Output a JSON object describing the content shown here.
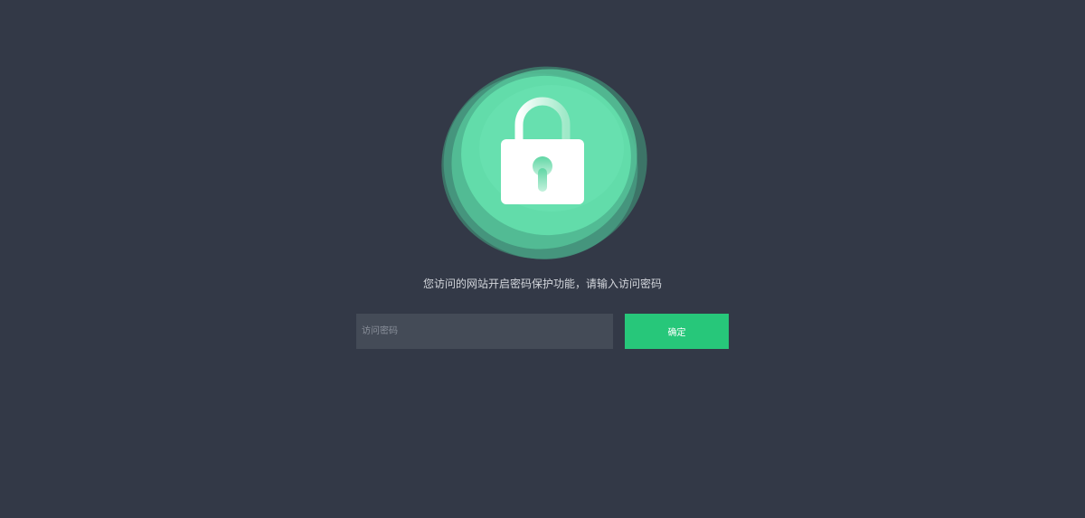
{
  "lock": {
    "icon": "padlock-icon",
    "colors": {
      "blob_dark": "#3f8a75",
      "blob_mid": "#4fb893",
      "blob_light": "#64e0ae",
      "lock_body": "#ffffff",
      "keyhole": "#6cdcad"
    }
  },
  "message": "您访问的网站开启密码保护功能，请输入访问密码",
  "form": {
    "password_placeholder": "访问密码",
    "password_value": "",
    "confirm_label": "确定"
  },
  "colors": {
    "background": "#333947",
    "input_background": "#444b57",
    "button": "#27c77a"
  }
}
